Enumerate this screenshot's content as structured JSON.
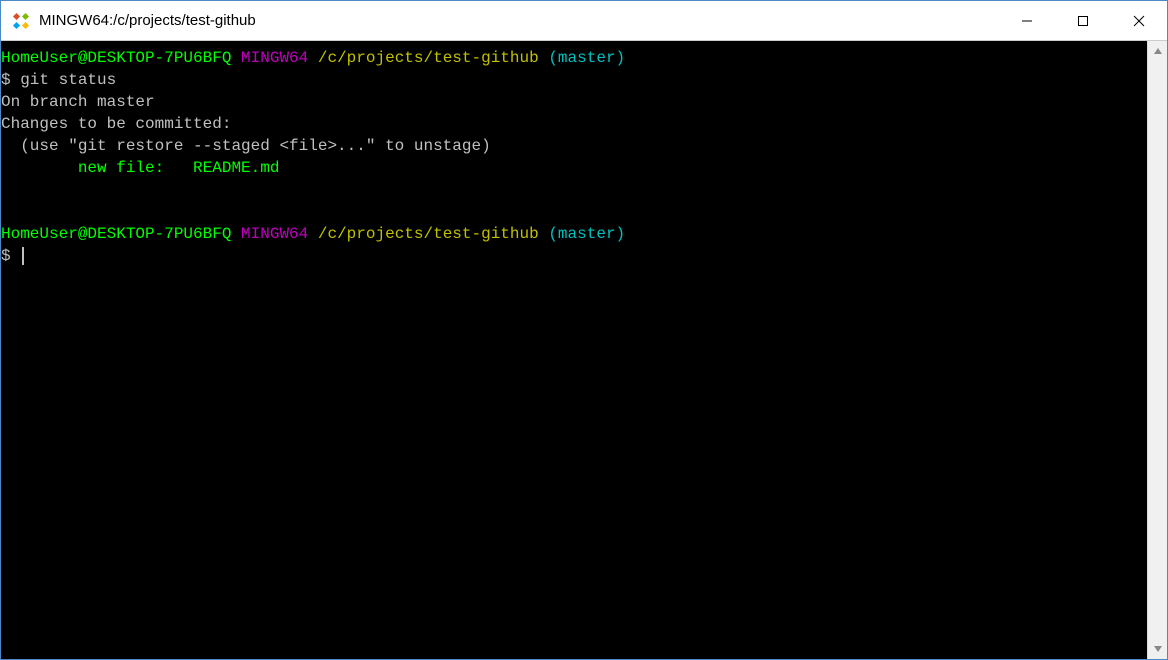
{
  "window": {
    "title": "MINGW64:/c/projects/test-github"
  },
  "prompt1": {
    "userhost": "HomeUser@DESKTOP-7PU6BFQ",
    "env": "MINGW64",
    "path": "/c/projects/test-github",
    "branch": "(master)"
  },
  "cmd1": {
    "prefix": "$ ",
    "text": "git status"
  },
  "out": {
    "line1": "On branch master",
    "line2": "Changes to be committed:",
    "line3": "  (use \"git restore --staged <file>...\" to unstage)",
    "line4": "        new file:   README.md"
  },
  "prompt2": {
    "userhost": "HomeUser@DESKTOP-7PU6BFQ",
    "env": "MINGW64",
    "path": "/c/projects/test-github",
    "branch": "(master)"
  },
  "cmd2": {
    "prefix": "$ "
  }
}
